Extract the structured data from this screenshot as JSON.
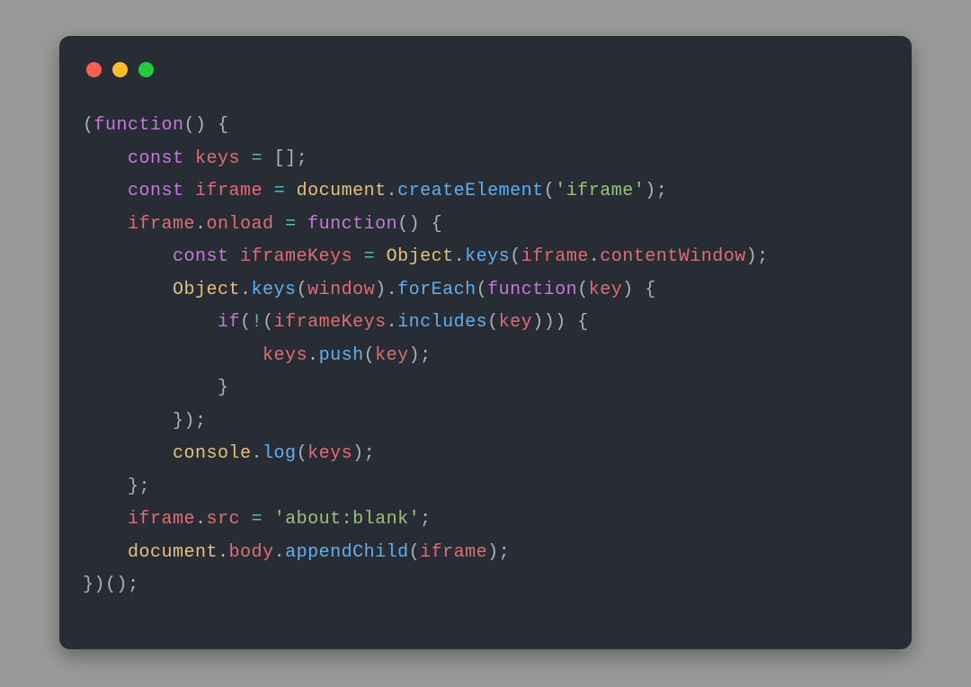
{
  "language": "javascript",
  "raw_code": "(function() {\n    const keys = [];\n    const iframe = document.createElement('iframe');\n    iframe.onload = function() {\n        const iframeKeys = Object.keys(iframe.contentWindow);\n        Object.keys(window).forEach(function(key) {\n            if(!(iframeKeys.includes(key))) {\n                keys.push(key);\n            }\n        });\n        console.log(keys);\n    };\n    iframe.src = 'about:blank';\n    document.body.appendChild(iframe);\n})();",
  "lines": [
    {
      "indent": 0,
      "tokens": [
        {
          "t": "(",
          "c": "pun"
        },
        {
          "t": "function",
          "c": "kw"
        },
        {
          "t": "(",
          "c": "pun"
        },
        {
          "t": ") ",
          "c": "pun"
        },
        {
          "t": "{",
          "c": "pun"
        }
      ]
    },
    {
      "indent": 1,
      "tokens": [
        {
          "t": "const",
          "c": "kw"
        },
        {
          "t": " ",
          "c": "pun"
        },
        {
          "t": "keys",
          "c": "id"
        },
        {
          "t": " ",
          "c": "pun"
        },
        {
          "t": "=",
          "c": "op"
        },
        {
          "t": " ",
          "c": "pun"
        },
        {
          "t": "[",
          "c": "pun"
        },
        {
          "t": "]",
          "c": "pun"
        },
        {
          "t": ";",
          "c": "pun"
        }
      ]
    },
    {
      "indent": 1,
      "tokens": [
        {
          "t": "const",
          "c": "kw"
        },
        {
          "t": " ",
          "c": "pun"
        },
        {
          "t": "iframe",
          "c": "id"
        },
        {
          "t": " ",
          "c": "pun"
        },
        {
          "t": "=",
          "c": "op"
        },
        {
          "t": " ",
          "c": "pun"
        },
        {
          "t": "document",
          "c": "gbl"
        },
        {
          "t": ".",
          "c": "pun"
        },
        {
          "t": "createElement",
          "c": "fn"
        },
        {
          "t": "(",
          "c": "pun"
        },
        {
          "t": "'iframe'",
          "c": "str"
        },
        {
          "t": ")",
          "c": "pun"
        },
        {
          "t": ";",
          "c": "pun"
        }
      ]
    },
    {
      "indent": 1,
      "tokens": [
        {
          "t": "iframe",
          "c": "id"
        },
        {
          "t": ".",
          "c": "pun"
        },
        {
          "t": "onload",
          "c": "prp"
        },
        {
          "t": " ",
          "c": "pun"
        },
        {
          "t": "=",
          "c": "op"
        },
        {
          "t": " ",
          "c": "pun"
        },
        {
          "t": "function",
          "c": "kw"
        },
        {
          "t": "(",
          "c": "pun"
        },
        {
          "t": ") ",
          "c": "pun"
        },
        {
          "t": "{",
          "c": "pun"
        }
      ]
    },
    {
      "indent": 2,
      "tokens": [
        {
          "t": "const",
          "c": "kw"
        },
        {
          "t": " ",
          "c": "pun"
        },
        {
          "t": "iframeKeys",
          "c": "id"
        },
        {
          "t": " ",
          "c": "pun"
        },
        {
          "t": "=",
          "c": "op"
        },
        {
          "t": " ",
          "c": "pun"
        },
        {
          "t": "Object",
          "c": "gbl"
        },
        {
          "t": ".",
          "c": "pun"
        },
        {
          "t": "keys",
          "c": "fn"
        },
        {
          "t": "(",
          "c": "pun"
        },
        {
          "t": "iframe",
          "c": "id"
        },
        {
          "t": ".",
          "c": "pun"
        },
        {
          "t": "contentWindow",
          "c": "prp"
        },
        {
          "t": ")",
          "c": "pun"
        },
        {
          "t": ";",
          "c": "pun"
        }
      ]
    },
    {
      "indent": 2,
      "tokens": [
        {
          "t": "Object",
          "c": "gbl"
        },
        {
          "t": ".",
          "c": "pun"
        },
        {
          "t": "keys",
          "c": "fn"
        },
        {
          "t": "(",
          "c": "pun"
        },
        {
          "t": "window",
          "c": "id"
        },
        {
          "t": ")",
          "c": "pun"
        },
        {
          "t": ".",
          "c": "pun"
        },
        {
          "t": "forEach",
          "c": "fn"
        },
        {
          "t": "(",
          "c": "pun"
        },
        {
          "t": "function",
          "c": "kw"
        },
        {
          "t": "(",
          "c": "pun"
        },
        {
          "t": "key",
          "c": "id"
        },
        {
          "t": ") ",
          "c": "pun"
        },
        {
          "t": "{",
          "c": "pun"
        }
      ]
    },
    {
      "indent": 3,
      "tokens": [
        {
          "t": "if",
          "c": "kw"
        },
        {
          "t": "(",
          "c": "pun"
        },
        {
          "t": "!",
          "c": "op"
        },
        {
          "t": "(",
          "c": "pun"
        },
        {
          "t": "iframeKeys",
          "c": "id"
        },
        {
          "t": ".",
          "c": "pun"
        },
        {
          "t": "includes",
          "c": "fn"
        },
        {
          "t": "(",
          "c": "pun"
        },
        {
          "t": "key",
          "c": "id"
        },
        {
          "t": ")",
          "c": "pun"
        },
        {
          "t": ")",
          "c": "pun"
        },
        {
          "t": ") ",
          "c": "pun"
        },
        {
          "t": "{",
          "c": "pun"
        }
      ]
    },
    {
      "indent": 4,
      "tokens": [
        {
          "t": "keys",
          "c": "id"
        },
        {
          "t": ".",
          "c": "pun"
        },
        {
          "t": "push",
          "c": "fn"
        },
        {
          "t": "(",
          "c": "pun"
        },
        {
          "t": "key",
          "c": "id"
        },
        {
          "t": ")",
          "c": "pun"
        },
        {
          "t": ";",
          "c": "pun"
        }
      ]
    },
    {
      "indent": 3,
      "tokens": [
        {
          "t": "}",
          "c": "pun"
        }
      ]
    },
    {
      "indent": 2,
      "tokens": [
        {
          "t": "}",
          "c": "pun"
        },
        {
          "t": ")",
          "c": "pun"
        },
        {
          "t": ";",
          "c": "pun"
        }
      ]
    },
    {
      "indent": 2,
      "tokens": [
        {
          "t": "console",
          "c": "gbl"
        },
        {
          "t": ".",
          "c": "pun"
        },
        {
          "t": "log",
          "c": "fn"
        },
        {
          "t": "(",
          "c": "pun"
        },
        {
          "t": "keys",
          "c": "id"
        },
        {
          "t": ")",
          "c": "pun"
        },
        {
          "t": ";",
          "c": "pun"
        }
      ]
    },
    {
      "indent": 1,
      "tokens": [
        {
          "t": "}",
          "c": "pun"
        },
        {
          "t": ";",
          "c": "pun"
        }
      ]
    },
    {
      "indent": 1,
      "tokens": [
        {
          "t": "iframe",
          "c": "id"
        },
        {
          "t": ".",
          "c": "pun"
        },
        {
          "t": "src",
          "c": "prp"
        },
        {
          "t": " ",
          "c": "pun"
        },
        {
          "t": "=",
          "c": "op"
        },
        {
          "t": " ",
          "c": "pun"
        },
        {
          "t": "'about:blank'",
          "c": "str"
        },
        {
          "t": ";",
          "c": "pun"
        }
      ]
    },
    {
      "indent": 1,
      "tokens": [
        {
          "t": "document",
          "c": "gbl"
        },
        {
          "t": ".",
          "c": "pun"
        },
        {
          "t": "body",
          "c": "prp"
        },
        {
          "t": ".",
          "c": "pun"
        },
        {
          "t": "appendChild",
          "c": "fn"
        },
        {
          "t": "(",
          "c": "pun"
        },
        {
          "t": "iframe",
          "c": "id"
        },
        {
          "t": ")",
          "c": "pun"
        },
        {
          "t": ";",
          "c": "pun"
        }
      ]
    },
    {
      "indent": 0,
      "tokens": [
        {
          "t": "}",
          "c": "pun"
        },
        {
          "t": ")",
          "c": "pun"
        },
        {
          "t": "(",
          "c": "pun"
        },
        {
          "t": ")",
          "c": "pun"
        },
        {
          "t": ";",
          "c": "pun"
        }
      ]
    }
  ]
}
